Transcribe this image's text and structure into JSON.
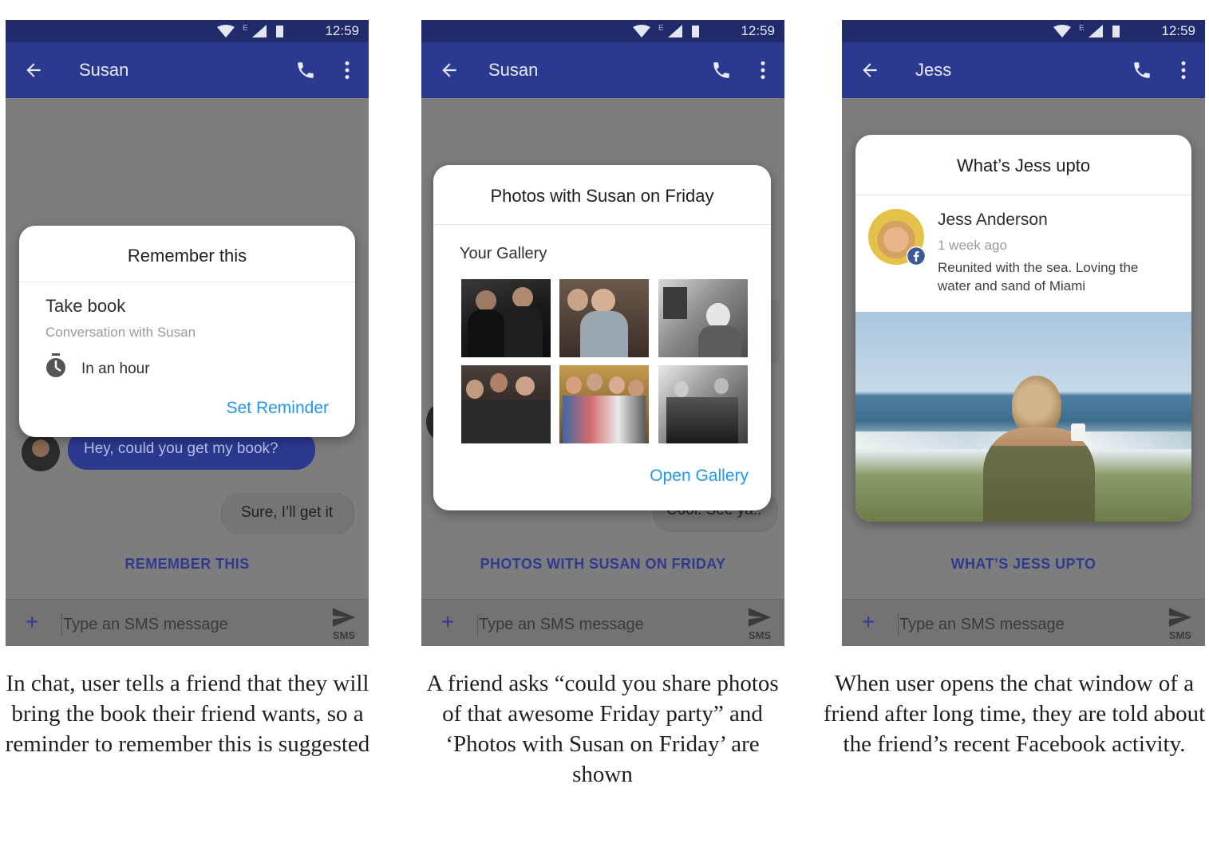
{
  "status": {
    "time": "12:59",
    "network": "E"
  },
  "composer": {
    "placeholder": "Type an SMS message",
    "plus": "+",
    "send_label": "SMS"
  },
  "screens": [
    {
      "contact": "Susan",
      "card": {
        "title": "Remember this",
        "item": "Take book",
        "subtitle": "Conversation with Susan",
        "time_label": "In an hour",
        "action": "Set Reminder"
      },
      "messages": [
        {
          "from": "friend",
          "text": "Hey, could you get my book?"
        },
        {
          "from": "me",
          "text": "Sure, I’ll get it"
        }
      ],
      "suggestion": "REMEMBER THIS",
      "caption": "In chat, user tells a friend that they will bring the book their friend wants, so a reminder to remember this is suggested"
    },
    {
      "contact": "Susan",
      "card": {
        "title": "Photos with Susan on Friday",
        "section": "Your Gallery",
        "action": "Open Gallery"
      },
      "hidden_message": "Cool. See ya..",
      "suggestion": "PHOTOS WITH SUSAN ON FRIDAY",
      "caption": "A friend asks “could you share photos of that awesome Friday party” and ‘Photos with Susan on Friday’ are shown"
    },
    {
      "contact": "Jess",
      "card": {
        "title": "What’s Jess upto",
        "name": "Jess Anderson",
        "time_ago": "1 week ago",
        "post": "Reunited with the sea. Loving the water and sand of Miami"
      },
      "suggestion": "WHAT’S JESS UPTO",
      "caption": "When user opens the chat window of a friend after long time, they are told about the friend’s recent Facebook activity."
    }
  ],
  "colors": {
    "appbar": "#2c3990",
    "statusbar": "#212b6c",
    "accent": "#2196f3",
    "suggestion": "#2e3b8f",
    "chat_bg": "#7d7d7d",
    "facebook": "#3b5998"
  },
  "icons": [
    "back-arrow-icon",
    "phone-icon",
    "more-vert-icon",
    "wifi-icon",
    "signal-icon",
    "battery-icon",
    "timer-icon",
    "send-icon",
    "facebook-icon"
  ]
}
